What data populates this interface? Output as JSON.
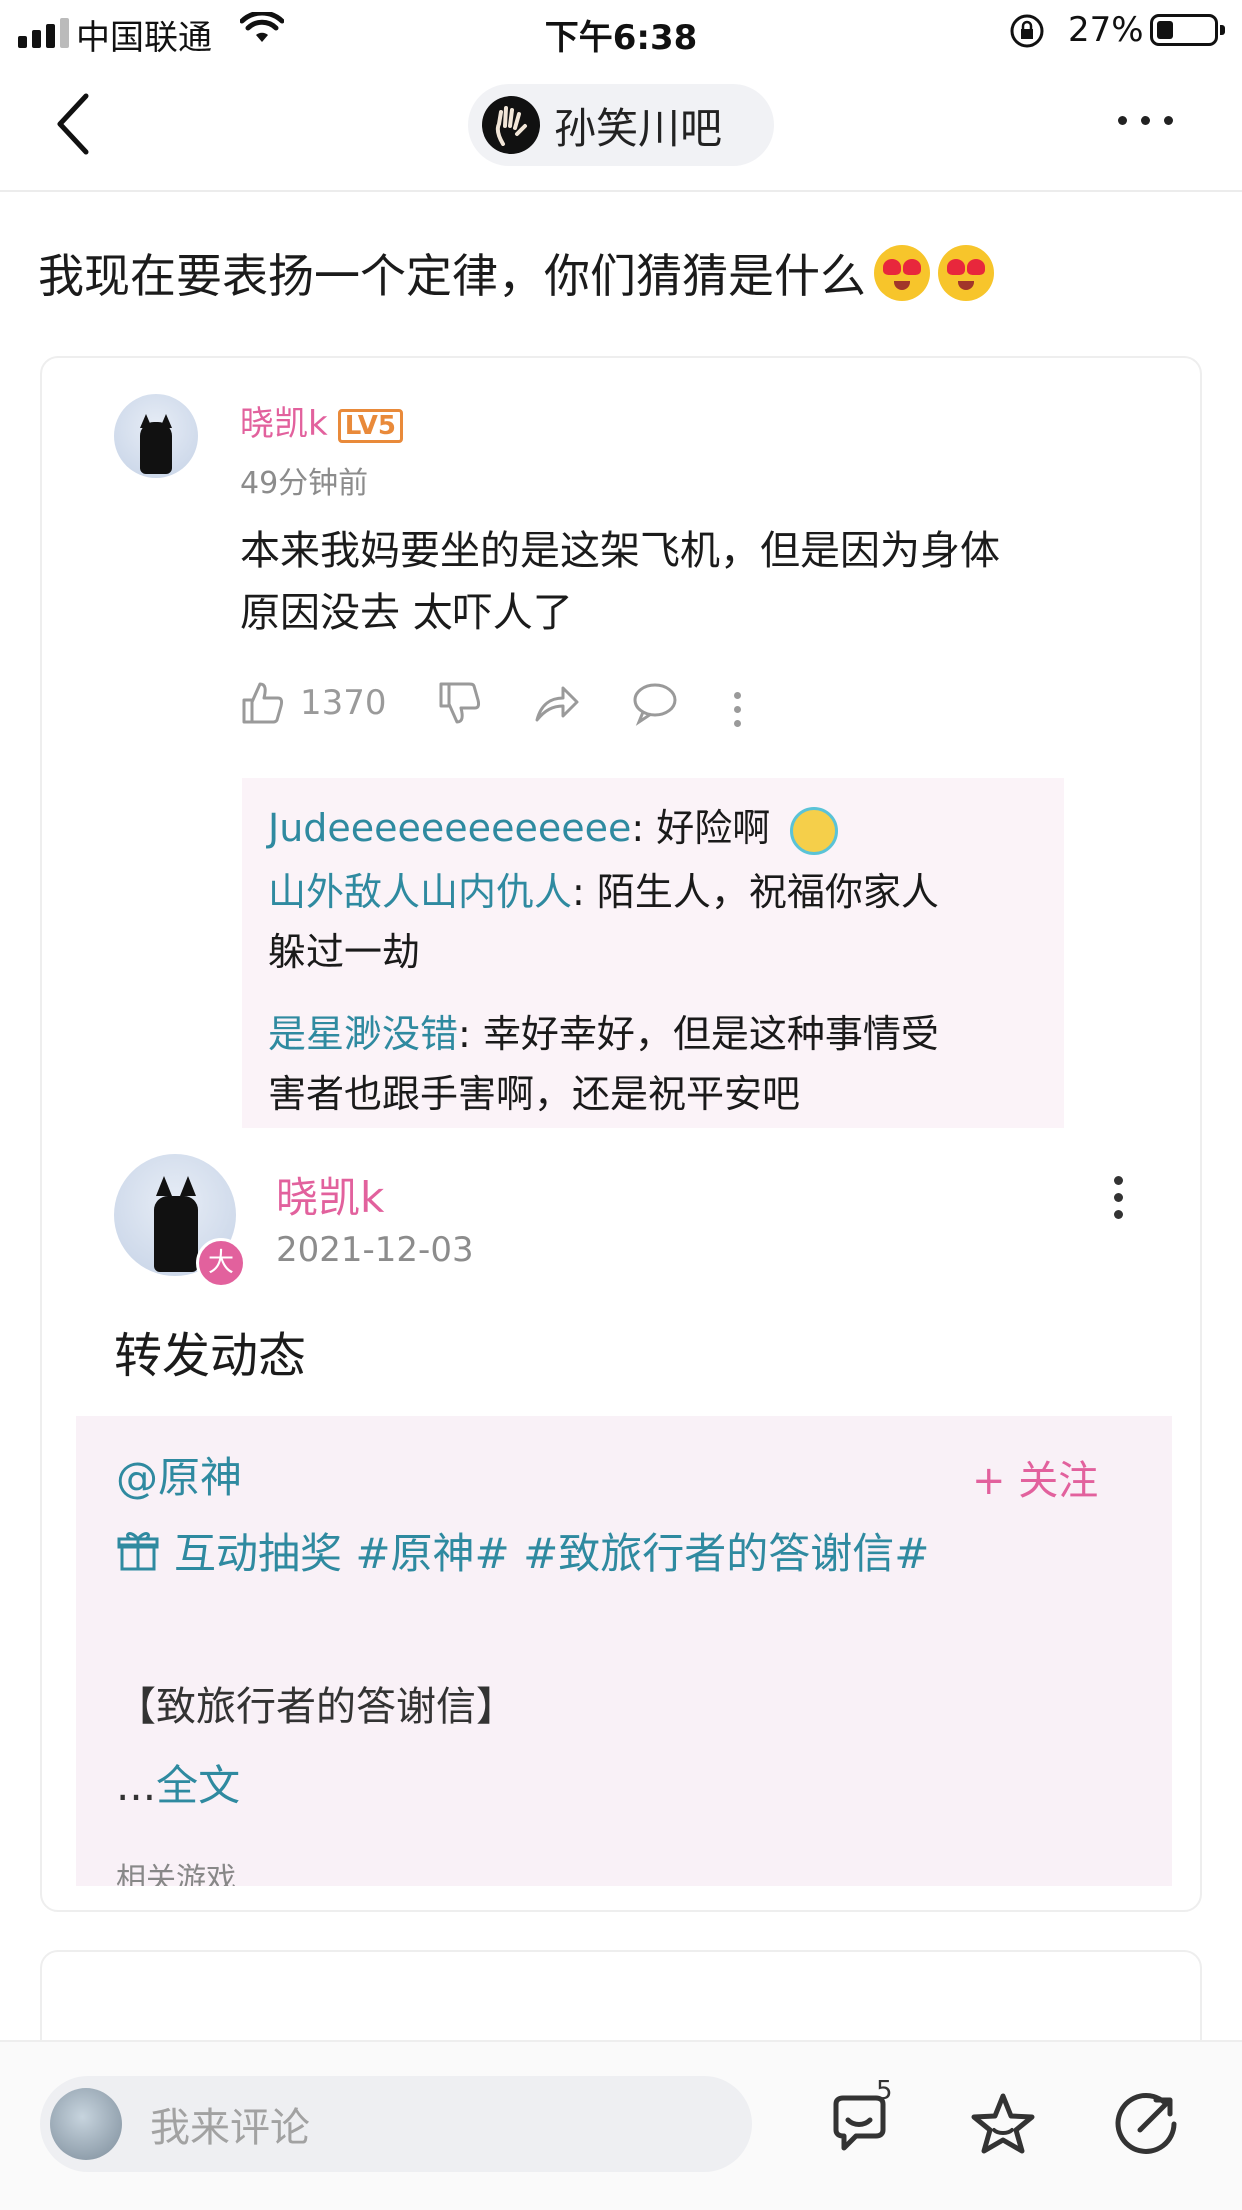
{
  "status_bar": {
    "carrier": "中国联通",
    "time": "下午6:38",
    "battery_percent": "27%"
  },
  "nav": {
    "forum_name": "孙笑川吧"
  },
  "post": {
    "title": "我现在要表扬一个定律，你们猜猜是什么"
  },
  "embedded_comment": {
    "username": "晓凯k",
    "level": "LV5",
    "time_ago": "49分钟前",
    "text_line1": "本来我妈要坐的是这架飞机，但是因为身体",
    "text_line2": "原因没去 太吓人了",
    "likes": "1370",
    "replies": [
      {
        "name": "Judeeeeeeeeeeeee",
        "text": ": 好险啊"
      },
      {
        "name": "山外敌人山内仇人",
        "text": ": 陌生人，祝福你家人",
        "text2": "躲过一劫"
      },
      {
        "name": "是星渺没错",
        "text": ": 幸好幸好，但是这种事情受",
        "text2": "害者也跟手害啊，还是祝平安吧"
      }
    ]
  },
  "embedded_post": {
    "username": "晓凯k",
    "avatar_badge": "大",
    "date": "2021-12-03",
    "text": "转发动态",
    "forward": {
      "at": "@原神",
      "follow": "+ 关注",
      "tags": "互动抽奖 #原神# #致旅行者的答谢信#",
      "letter_title": "【致旅行者的答谢信】",
      "ellipsis": "...",
      "fulltext": "全文",
      "cut_text": "相关游戏"
    }
  },
  "bottom_bar": {
    "comment_placeholder": "我来评论",
    "comment_count": "5"
  },
  "colors": {
    "pink_name": "#e2619d",
    "teal_link": "#2f8aa0",
    "level_orange": "#e98a3a"
  }
}
